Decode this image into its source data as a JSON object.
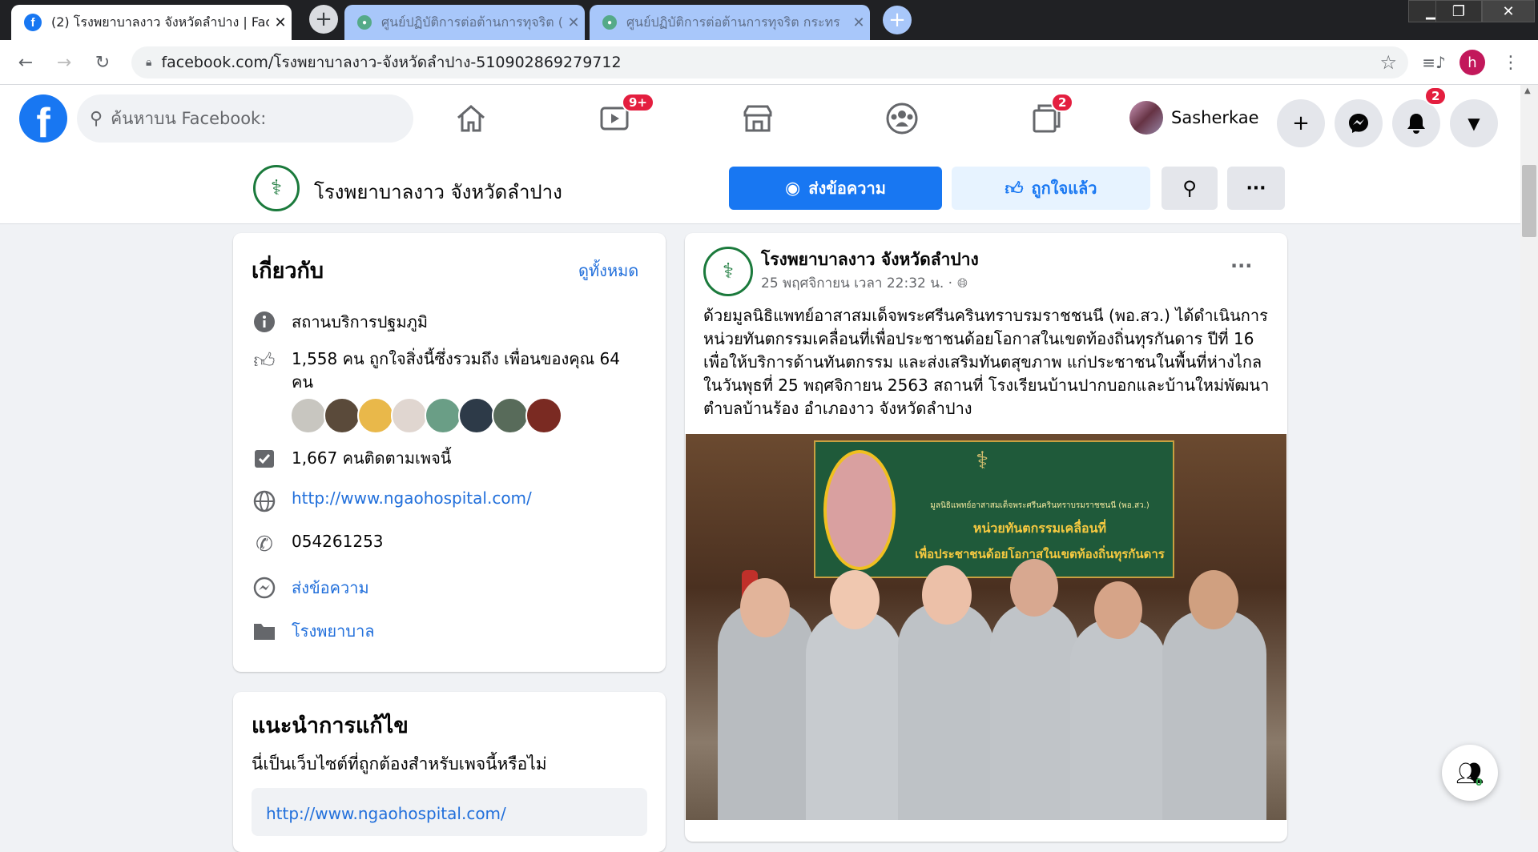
{
  "browser": {
    "active_tab_title": "(2) โรงพยาบาลงาว จังหวัดลำปาง | Fac",
    "tab2_title": "ศูนย์ปฏิบัติการต่อต้านการทุจริต (ศปท.)",
    "tab3_title": "ศูนย์ปฏิบัติการต่อต้านการทุจริต กระทร",
    "url": "facebook.com/โรงพยาบาลงาว-จังหวัดลำปาง-510902869279712",
    "profile_initial": "h"
  },
  "fb": {
    "search_placeholder": "ค้นหาบน Facebook:",
    "watch_badge": "9+",
    "pages_badge": "2",
    "notif_badge": "2",
    "user_name": "Sasherkae"
  },
  "page": {
    "name": "โรงพยาบาลงาว จังหวัดลำปาง",
    "message_btn": "ส่งข้อความ",
    "liked_btn": "ถูกใจแล้ว"
  },
  "about": {
    "title": "เกี่ยวกับ",
    "see_all": "ดูทั้งหมด",
    "category": "สถานบริการปฐมภูมิ",
    "likes_text": "1,558 คน ถูกใจสิ่งนี้ซึ่งรวมถึง เพื่อนของคุณ 64 คน",
    "followers": "1,667 คนติดตามเพจนี้",
    "website": "http://www.ngaohospital.com/",
    "phone": "054261253",
    "send_message": "ส่งข้อความ",
    "page_type": "โรงพยาบาล"
  },
  "suggest": {
    "title": "แนะนำการแก้ไข",
    "question": "นี่เป็นเว็บไซต์ที่ถูกต้องสำหรับเพจนี้หรือไม่",
    "url": "http://www.ngaohospital.com/"
  },
  "post": {
    "author": "โรงพยาบาลงาว จังหวัดลำปาง",
    "time": "25 พฤศจิกายน เวลา 22:32 น. ·",
    "text": "ด้วยมูลนิธิแพทย์อาสาสมเด็จพระศรีนครินทราบรมราชชนนี (พอ.สว.) ได้ดำเนินการหน่วยทันตกรรมเคลื่อนที่เพื่อประชาชนด้อยโอกาสในเขตท้องถิ่นทุรกันดาร ปีที่ 16 เพื่อให้บริการด้านทันตกรรม และส่งเสริมทันตสุขภาพ แก่ประชาชนในพื้นที่ห่างไกล ในวันพุธที่ 25 พฤศจิกายน 2563 สถานที่ โรงเรียนบ้านปากบอกและบ้านใหม่พัฒนา ตำบลบ้านร้อง อำเภองาว จังหวัดลำปาง",
    "banner_line1": "มูลนิธิแพทย์อาสาสมเด็จพระศรีนครินทราบรมราชชนนี (พอ.สว.)",
    "banner_line2": "หน่วยทันตกรรมเคลื่อนที่",
    "banner_line3": "เพื่อประชาชนด้อยโอกาสในเขตท้องถิ่นทุรกันดาร"
  },
  "chat": {
    "count": "0"
  },
  "colors": {
    "fb_blue": "#1877f2",
    "badge_red": "#e41e3f",
    "link": "#216fdb"
  }
}
